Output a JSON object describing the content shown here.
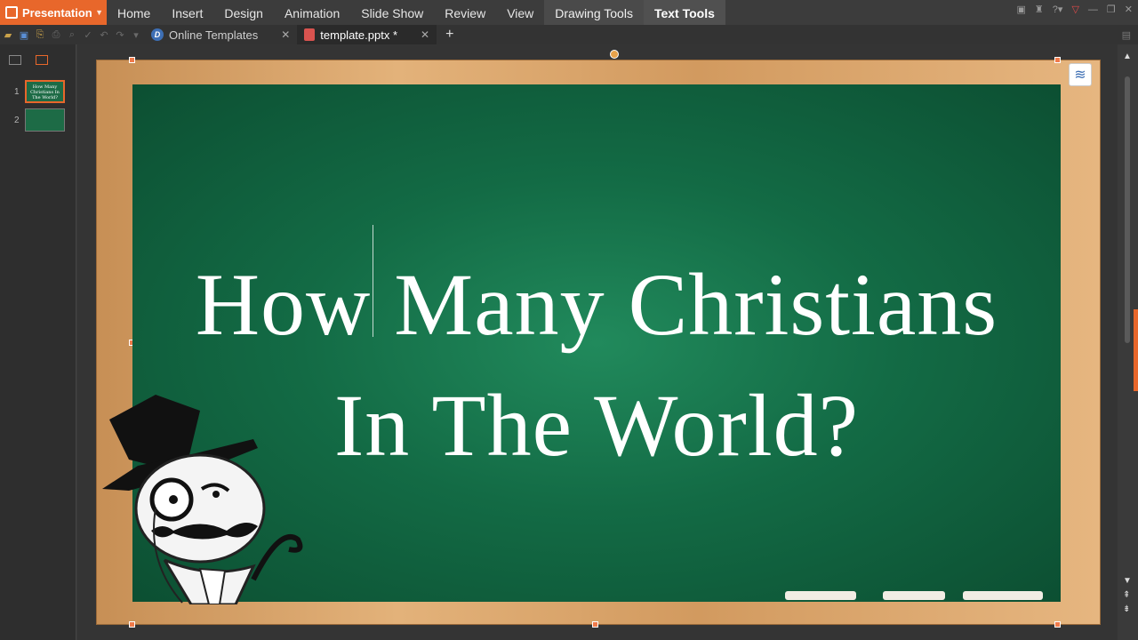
{
  "app_button": {
    "label": "Presentation"
  },
  "menu": {
    "items": [
      "Home",
      "Insert",
      "Design",
      "Animation",
      "Slide Show",
      "Review",
      "View"
    ],
    "contextual": [
      "Drawing Tools",
      "Text Tools"
    ]
  },
  "tabs": [
    {
      "label": "Online Templates",
      "icon": "online-templates-icon"
    },
    {
      "label": "template.pptx *",
      "icon": "pptx-file-icon",
      "current": true
    }
  ],
  "thumbnails": [
    {
      "number": "1",
      "text": "How Many Christians In The World?",
      "selected": true
    },
    {
      "number": "2",
      "text": ""
    }
  ],
  "slide": {
    "title_line1": "How Many Christians",
    "title_line2": "In The World?"
  },
  "colors": {
    "accent": "#e8672b",
    "chalkboard": "#1a7a50",
    "frame": "#d9a56b"
  }
}
